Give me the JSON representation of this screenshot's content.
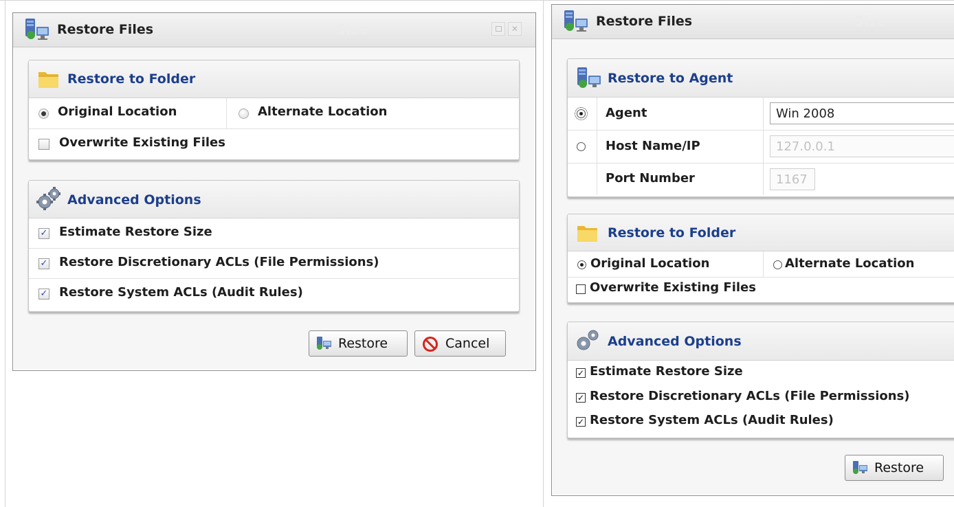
{
  "left_dialog": {
    "title": "Restore Files",
    "ghost_header": "Size",
    "restore_folder": {
      "header": "Restore to Folder",
      "original_location": "Original Location",
      "alternate_location": "Alternate Location",
      "overwrite": "Overwrite Existing Files"
    },
    "advanced": {
      "header": "Advanced Options",
      "options": [
        {
          "label": "Estimate Restore Size",
          "checked": true
        },
        {
          "label": "Restore Discretionary ACLs (File Permissions)",
          "checked": true
        },
        {
          "label": "Restore System ACLs (Audit Rules)",
          "checked": true
        }
      ]
    },
    "restore_button": "Restore",
    "cancel_button": "Cancel"
  },
  "right_dialog": {
    "title": "Restore Files",
    "ghost_header": "Size",
    "restore_agent": {
      "header": "Restore to Agent",
      "agent_label": "Agent",
      "agent_value": "Win 2008",
      "host_label": "Host Name/IP",
      "host_value": "127.0.0.1",
      "port_label": "Port Number",
      "port_value": "1167"
    },
    "restore_folder": {
      "header": "Restore to Folder",
      "original_location": "Original Location",
      "alternate_location": "Alternate Location",
      "overwrite": "Overwrite Existing Files"
    },
    "advanced": {
      "header": "Advanced Options",
      "options": [
        {
          "label": "Estimate Restore Size",
          "checked": true
        },
        {
          "label": "Restore Discretionary ACLs (File Permissions)",
          "checked": true
        },
        {
          "label": "Restore System ACLs (Audit Rules)",
          "checked": true
        }
      ]
    },
    "restore_button": "Restore"
  },
  "colors": {
    "header_text": "#1c3f8c",
    "dialog_border": "#8f8f8f",
    "cancel_red": "#d8231c"
  },
  "check_glyph": "✓",
  "check_glyph_right": "✓"
}
